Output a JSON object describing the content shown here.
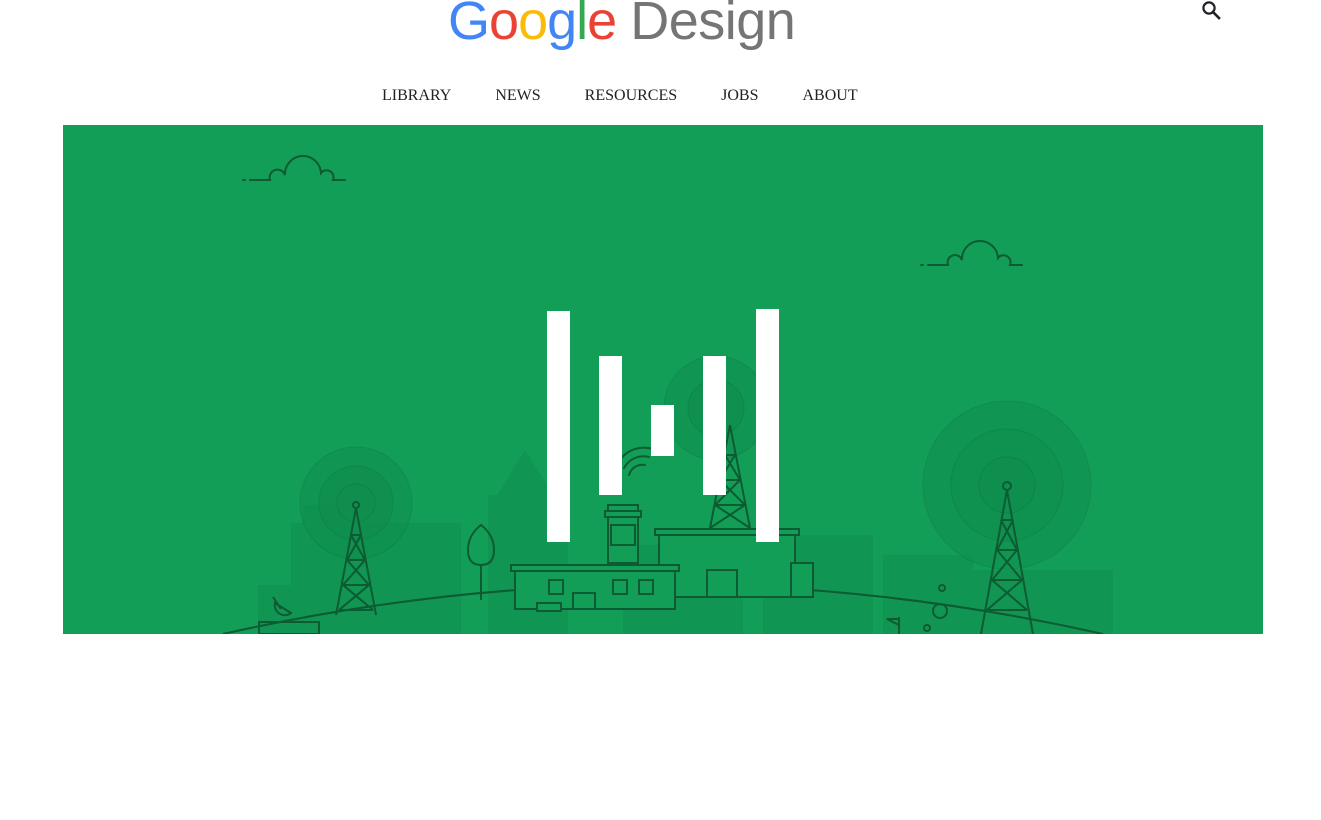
{
  "header": {
    "logo": {
      "google_letters": [
        {
          "char": "G",
          "color": "#4285F4"
        },
        {
          "char": "o",
          "color": "#EA4335"
        },
        {
          "char": "o",
          "color": "#FBBC05"
        },
        {
          "char": "g",
          "color": "#4285F4"
        },
        {
          "char": "l",
          "color": "#34A853"
        },
        {
          "char": "e",
          "color": "#EA4335"
        }
      ],
      "suffix": "Design",
      "suffix_color": "#757575"
    },
    "search_icon": "search-icon"
  },
  "nav": {
    "items": [
      {
        "label": "LIBRARY"
      },
      {
        "label": "NEWS"
      },
      {
        "label": "RESOURCES"
      },
      {
        "label": "JOBS"
      },
      {
        "label": "ABOUT"
      }
    ]
  },
  "hero": {
    "background_color": "#139E57",
    "line_color": "#0D5A33",
    "logo_mark_color": "#FFFFFF",
    "illustration": "city-with-radio-towers-illustration"
  }
}
